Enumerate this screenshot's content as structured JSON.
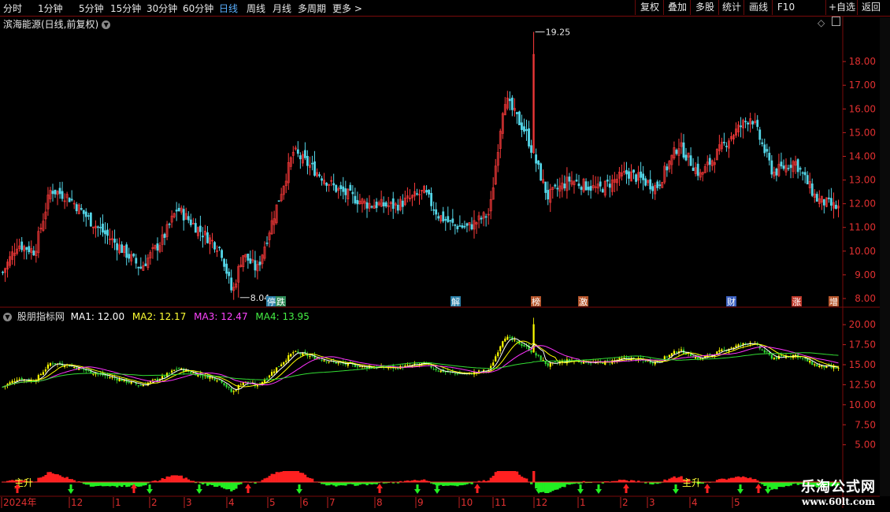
{
  "toolbar": {
    "timeframes": [
      "分时",
      "1分钟",
      "5分钟",
      "15分钟",
      "30分钟",
      "60分钟",
      "日线",
      "周线",
      "月线",
      "多周期",
      "更多 >"
    ],
    "active": "日线",
    "right_buttons": [
      "复权",
      "叠加",
      "多股",
      "统计",
      "画线",
      "F10",
      "+自选",
      "返回"
    ]
  },
  "main": {
    "title": "滨海能源(日线,前复权)",
    "price_ticks": [
      "18.00",
      "17.00",
      "16.00",
      "15.00",
      "14.00",
      "13.00",
      "12.00",
      "11.00",
      "10.00",
      "9.00",
      "8.00"
    ],
    "high_label": "19.25",
    "low_label": "8.04",
    "event_markers": [
      {
        "text": "停",
        "color": "#2a7fa8"
      },
      {
        "text": "跌",
        "color": "#2e8b57"
      },
      {
        "text": "解",
        "color": "#2a7fa8"
      },
      {
        "text": "榜",
        "color": "#b5552b"
      },
      {
        "text": "激",
        "color": "#b5552b"
      },
      {
        "text": "财",
        "color": "#3a5fbf"
      },
      {
        "text": "涨",
        "color": "#c0392b"
      },
      {
        "text": "增",
        "color": "#b5552b"
      }
    ]
  },
  "indicator": {
    "name": "股朋指标网",
    "ma1_label": "MA1: 12.00",
    "ma2_label": "MA2: 12.17",
    "ma3_label": "MA3: 12.47",
    "ma4_label": "MA4: 13.95",
    "ticks": [
      "20.00",
      "17.50",
      "15.00",
      "12.50",
      "10.00",
      "7.50",
      "5.00"
    ],
    "main_rise_labels": [
      "主升",
      "主升"
    ]
  },
  "timeline": {
    "labels": [
      "2024年",
      "12",
      "1",
      "2",
      "3",
      "4",
      "5",
      "6",
      "7",
      "8",
      "9",
      "10",
      "11",
      "12",
      "1",
      "2",
      "3",
      "4",
      "5"
    ]
  },
  "watermark": {
    "line1": "乐淘公式网",
    "line2": "www.60lt.com"
  },
  "colors": {
    "up": "#ff3b3b",
    "down": "#54d6e8",
    "ma1": "#ffffff",
    "ma2": "#ffff00",
    "ma3": "#ff33ff",
    "ma4": "#33dd33",
    "grid": "#7a0a0a"
  },
  "chart_data": {
    "type": "candlestick",
    "title": "滨海能源(日线,前复权)",
    "ylim": [
      7.7,
      19.6
    ],
    "y_ticks": [
      8,
      9,
      10,
      11,
      12,
      13,
      14,
      15,
      16,
      17,
      18
    ],
    "annotations": [
      {
        "text": "19.25",
        "value": 19.25,
        "kind": "high"
      },
      {
        "text": "8.04",
        "value": 8.04,
        "kind": "low"
      }
    ],
    "close_path": [
      {
        "t": 0,
        "v": 9.1
      },
      {
        "t": 10,
        "v": 10.3
      },
      {
        "t": 22,
        "v": 10.0
      },
      {
        "t": 33,
        "v": 12.6
      },
      {
        "t": 45,
        "v": 12.3
      },
      {
        "t": 60,
        "v": 11.3
      },
      {
        "t": 80,
        "v": 10.2
      },
      {
        "t": 95,
        "v": 9.3
      },
      {
        "t": 110,
        "v": 10.5
      },
      {
        "t": 120,
        "v": 11.8
      },
      {
        "t": 135,
        "v": 10.9
      },
      {
        "t": 150,
        "v": 10.1
      },
      {
        "t": 158,
        "v": 8.2
      },
      {
        "t": 165,
        "v": 9.9
      },
      {
        "t": 175,
        "v": 9.2
      },
      {
        "t": 200,
        "v": 14.2
      },
      {
        "t": 215,
        "v": 13.4
      },
      {
        "t": 230,
        "v": 12.6
      },
      {
        "t": 250,
        "v": 12.0
      },
      {
        "t": 270,
        "v": 11.9
      },
      {
        "t": 290,
        "v": 12.5
      },
      {
        "t": 300,
        "v": 11.5
      },
      {
        "t": 310,
        "v": 11.1
      },
      {
        "t": 320,
        "v": 11.0
      },
      {
        "t": 335,
        "v": 11.6
      },
      {
        "t": 345,
        "v": 16.5
      },
      {
        "t": 360,
        "v": 15.0
      },
      {
        "t": 375,
        "v": 12.3
      },
      {
        "t": 390,
        "v": 13.0
      },
      {
        "t": 410,
        "v": 12.6
      },
      {
        "t": 430,
        "v": 13.3
      },
      {
        "t": 450,
        "v": 12.7
      },
      {
        "t": 465,
        "v": 14.5
      },
      {
        "t": 480,
        "v": 13.2
      },
      {
        "t": 500,
        "v": 14.8
      },
      {
        "t": 515,
        "v": 15.7
      },
      {
        "t": 530,
        "v": 13.3
      },
      {
        "t": 545,
        "v": 13.8
      },
      {
        "t": 560,
        "v": 12.2
      },
      {
        "t": 575,
        "v": 11.8
      }
    ],
    "indicator_series": [
      {
        "name": "MA1",
        "value": 12.0
      },
      {
        "name": "MA2",
        "value": 12.17
      },
      {
        "name": "MA3",
        "value": 12.47
      },
      {
        "name": "MA4",
        "value": 13.95
      }
    ],
    "indicator_ylim": [
      3.0,
      21.0
    ],
    "indicator_ticks": [
      20.0,
      17.5,
      15.0,
      12.5,
      10.0,
      7.5,
      5.0
    ]
  }
}
